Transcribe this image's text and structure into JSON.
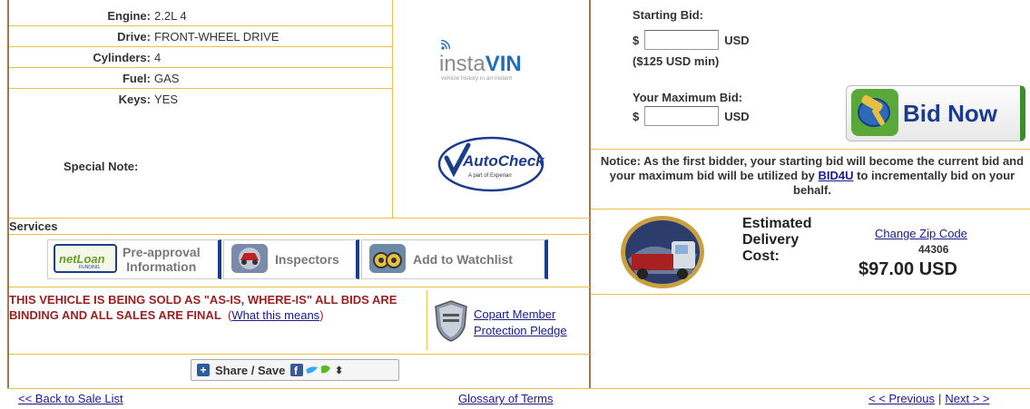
{
  "specs": [
    {
      "label": "Engine:",
      "value": "2.2L 4"
    },
    {
      "label": "Drive:",
      "value": "FRONT-WHEEL DRIVE"
    },
    {
      "label": "Cylinders:",
      "value": "4"
    },
    {
      "label": "Fuel:",
      "value": "GAS"
    },
    {
      "label": "Keys:",
      "value": "YES"
    }
  ],
  "special_note_label": "Special Note:",
  "logos": {
    "instavin_name": "instaVIN",
    "instavin_tagline": "vehicle history in an instant",
    "autocheck_name": "AutoCheck",
    "autocheck_tagline": "A part of Experian"
  },
  "services": {
    "title": "Services",
    "loan_logo": "netLoan",
    "loan_label_1": "Pre-approval",
    "loan_label_2": "Information",
    "inspectors_label": "Inspectors",
    "watchlist_label": "Add to Watchlist"
  },
  "asis": {
    "text": "THIS VEHICLE IS BEING SOLD AS \"AS-IS, WHERE-IS\" ALL BIDS ARE BINDING AND ALL SALES ARE FINAL",
    "open_paren": "(",
    "link_part1": "What this",
    "link_part2": "means",
    "close_paren": ")"
  },
  "pledge": {
    "line1": "Copart Member",
    "line2": "Protection Pledge"
  },
  "share": {
    "label": "Share / Save"
  },
  "bid": {
    "starting_label": "Starting Bid:",
    "dollar": "$",
    "usd": "USD",
    "min_note": "($125 USD min)",
    "max_label": "Your Maximum Bid:",
    "bid_now_label": "Bid Now"
  },
  "notice": {
    "text_before": "Notice: As the first bidder, your starting bid will become the current bid and your maximum bid will be utilized by ",
    "link": "BID4U",
    "text_after": " to incrementally bid on your behalf."
  },
  "delivery": {
    "label_1": "Estimated",
    "label_2": "Delivery",
    "label_3": "Cost:",
    "change_zip": "Change Zip Code",
    "zip": "44306",
    "cost": "$97.00 USD"
  },
  "nav": {
    "back": "<< Back to Sale List",
    "glossary": "Glossary of Terms",
    "previous": "< < Previous",
    "separator": "|",
    "next": "Next > >"
  },
  "colors": {
    "divider": "#f0c040",
    "frame": "#a0784c",
    "warning_text": "#9a1f1f",
    "link": "#1a1a8c",
    "bid_now_text": "#1a3c8c"
  }
}
